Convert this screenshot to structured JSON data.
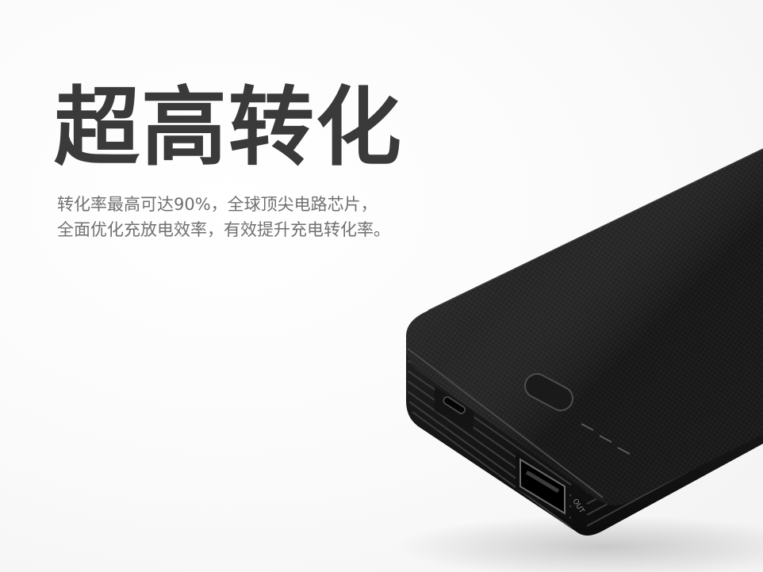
{
  "headline": "超高转化",
  "description": {
    "line1": "转化率最高可达90%，全球顶尖电路芯片，",
    "line2": "全面优化充放电效率，有效提升充电转化率。"
  },
  "product": {
    "type": "power-bank",
    "color": "#1c1c1c",
    "port_label_out": "OUT"
  },
  "colors": {
    "headline": "#3a3a3a",
    "body_text": "#707070",
    "background": "#ffffff"
  }
}
